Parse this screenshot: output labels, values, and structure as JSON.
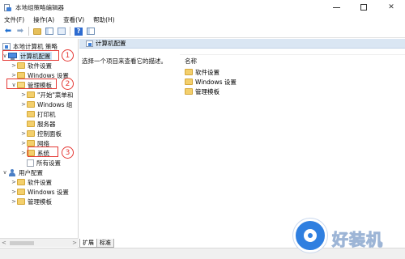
{
  "window": {
    "title": "本地组策略编辑器",
    "minimize_icon": "minimize-icon",
    "maximize_icon": "maximize-icon",
    "close_glyph": "✕"
  },
  "menu": {
    "items": [
      "文件(F)",
      "操作(A)",
      "查看(V)",
      "帮助(H)"
    ]
  },
  "toolbar": {
    "back_glyph": "⬅",
    "forward_glyph": "➡",
    "help_glyph": "?"
  },
  "tree": {
    "root": "本地计算机 策略",
    "computer_config": "计算机配置",
    "software_settings": "软件设置",
    "windows_settings": "Windows 设置",
    "admin_templates": "管理模板",
    "start_menu": "\"开始\"菜单和",
    "windows_components": "Windows 组",
    "printers": "打印机",
    "server": "服务器",
    "control_panel": "控制面板",
    "network": "网络",
    "system": "系统",
    "all_settings": "所有设置",
    "user_config": "用户配置",
    "user_software_settings": "软件设置",
    "user_windows_settings": "Windows 设置",
    "user_admin_templates": "管理模板"
  },
  "annotations": {
    "step1": "1",
    "step2": "2",
    "step3": "3",
    "color": "#e53935"
  },
  "right_pane": {
    "header": "计算机配置",
    "description": "选择一个项目来查看它的描述。",
    "column_name": "名称",
    "items": [
      "软件设置",
      "Windows 设置",
      "管理模板"
    ]
  },
  "tabs": {
    "extended": "扩展",
    "standard": "标准"
  },
  "watermark": {
    "text": "好装机"
  },
  "colors": {
    "header_bg": "#dae6f3",
    "selection": "#cce4f7",
    "folder": "#f3cf6c",
    "accent": "#1f6fd1"
  }
}
